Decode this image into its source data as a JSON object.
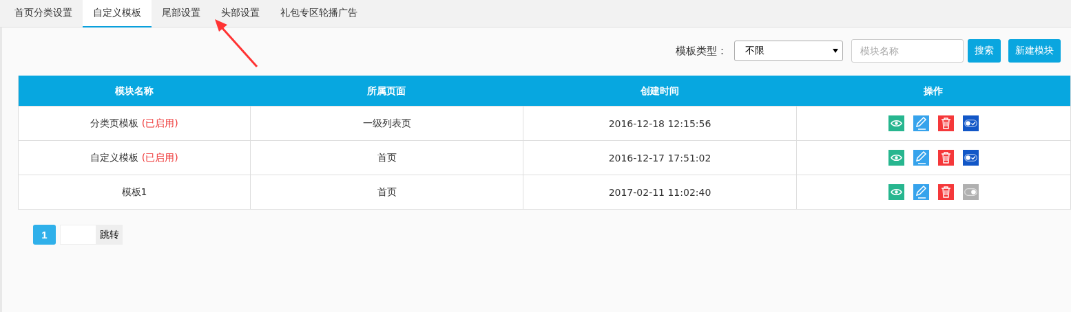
{
  "tabs": [
    {
      "label": "首页分类设置",
      "selected": false
    },
    {
      "label": "自定义模板",
      "selected": true
    },
    {
      "label": "尾部设置",
      "selected": false
    },
    {
      "label": "头部设置",
      "selected": false
    },
    {
      "label": "礼包专区轮播广告",
      "selected": false
    }
  ],
  "filter": {
    "label": "模板类型：",
    "select_value": "不限",
    "search_placeholder": "模块名称",
    "search_button": "搜索",
    "new_button": "新建模块"
  },
  "table": {
    "columns": [
      "模块名称",
      "所属页面",
      "创建时间",
      "操作"
    ],
    "rows": [
      {
        "name": "分类页模板",
        "status": "(已启用)",
        "page": "一级列表页",
        "created": "2016-12-18 12:15:56",
        "enabled": true
      },
      {
        "name": "自定义模板",
        "status": "(已启用)",
        "page": "首页",
        "created": "2016-12-17 17:51:02",
        "enabled": true
      },
      {
        "name": "模板1",
        "page": "首页",
        "created": "2017-02-11 11:02:40",
        "enabled": false
      }
    ]
  },
  "pagination": {
    "pages": [
      {
        "label": "1",
        "selected": true
      }
    ],
    "jump_button": "跳转"
  }
}
